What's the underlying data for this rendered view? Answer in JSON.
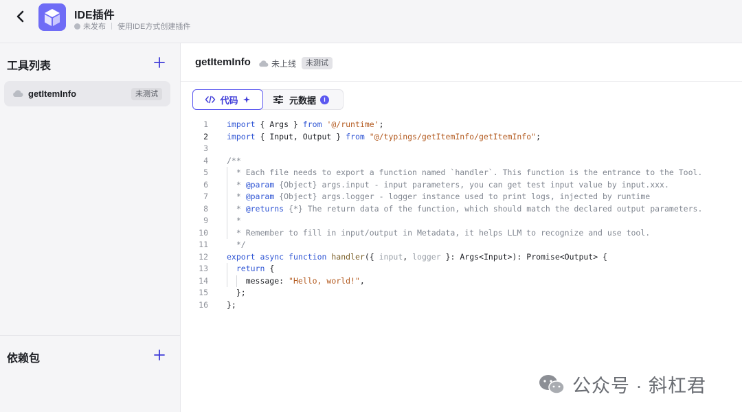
{
  "header": {
    "title": "IDE插件",
    "status": "未发布",
    "subtitle": "使用IDE方式创建插件"
  },
  "sidebar": {
    "tools_title": "工具列表",
    "tools": [
      {
        "name": "getItemInfo",
        "badge": "未测试"
      }
    ],
    "deps_title": "依赖包"
  },
  "main": {
    "title": "getItemInfo",
    "status": "未上线",
    "badge": "未测试",
    "tabs": [
      {
        "label": "代码",
        "active": true
      },
      {
        "label": "元数据",
        "active": false
      }
    ]
  },
  "code": {
    "current_line": 2,
    "lines": [
      "import { Args } from '@/runtime';",
      "import { Input, Output } from \"@/typings/getItemInfo/getItemInfo\";",
      "",
      "/**",
      "  * Each file needs to export a function named `handler`. This function is the entrance to the Tool.",
      "  * @param {Object} args.input - input parameters, you can get test input value by input.xxx.",
      "  * @param {Object} args.logger - logger instance used to print logs, injected by runtime",
      "  * @returns {*} The return data of the function, which should match the declared output parameters.",
      "  *",
      "  * Remember to fill in input/output in Metadata, it helps LLM to recognize and use tool.",
      "  */",
      "export async function handler({ input, logger }: Args<Input>): Promise<Output> {",
      "  return {",
      "    message: \"Hello, world!\",",
      "  };",
      "};"
    ]
  },
  "watermark": "公众号 · 斜杠君",
  "colors": {
    "accent": "#5b58f0",
    "logo": "#6f6cf6",
    "keyword": "#2f55d4",
    "string": "#b35a1f"
  },
  "icons": [
    "back-arrow-icon",
    "cube-icon",
    "plus-icon",
    "cloud-icon",
    "code-icon",
    "sparkle-icon",
    "sliders-icon",
    "info-icon",
    "wechat-icon"
  ]
}
